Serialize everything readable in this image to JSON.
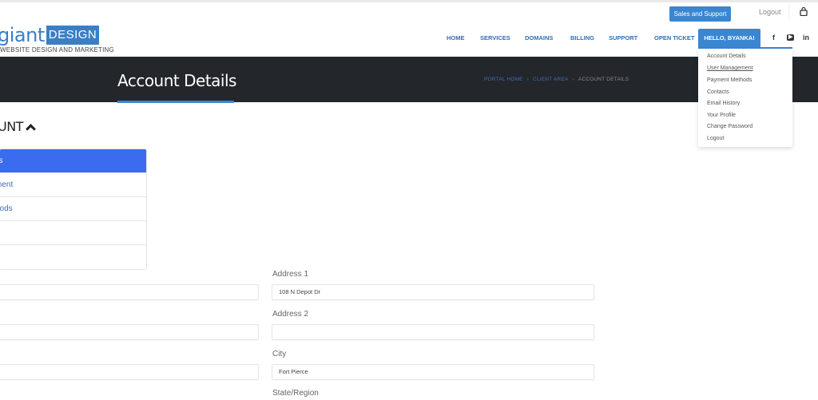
{
  "brand": {
    "logo_word": "giant",
    "logo_badge": "DESIGN",
    "tagline": "WEBSITE DESIGN AND MARKETING",
    "accent_color": "#3a86d1"
  },
  "topbar": {
    "sales_button": "Sales and Support",
    "logout": "Logout",
    "cart_icon": "lock-bag-icon"
  },
  "nav": {
    "items": [
      "HOME",
      "SERVICES",
      "DOMAINS",
      "BILLING",
      "SUPPORT",
      "OPEN TICKET"
    ],
    "user_menu": "HELLO, BYANKA!",
    "social": {
      "facebook": "f",
      "youtube": "▶",
      "linkedin": "in"
    }
  },
  "user_dropdown": {
    "items": [
      "Account Details",
      "User Management",
      "Payment Methods",
      "Contacts",
      "Email History",
      "Your Profile",
      "Change Password",
      "Logout"
    ],
    "hovered_index": 1
  },
  "banner": {
    "title": "Account Details",
    "breadcrumb": [
      "PORTAL HOME",
      "CLIENT AREA",
      "ACCOUNT DETAILS"
    ],
    "separator": "›"
  },
  "sidebar": {
    "heading": "UNT",
    "items": [
      "ils",
      "ment",
      "hods",
      "",
      ""
    ],
    "active_index": 0
  },
  "form": {
    "left_fields": [
      "",
      "",
      ""
    ],
    "right_fields": [
      {
        "label": "Address 1",
        "value": "108 N Depot Dr"
      },
      {
        "label": "Address 2",
        "value": ""
      },
      {
        "label": "City",
        "value": "Fort Pierce"
      },
      {
        "label": "State/Region",
        "value": ""
      }
    ]
  }
}
